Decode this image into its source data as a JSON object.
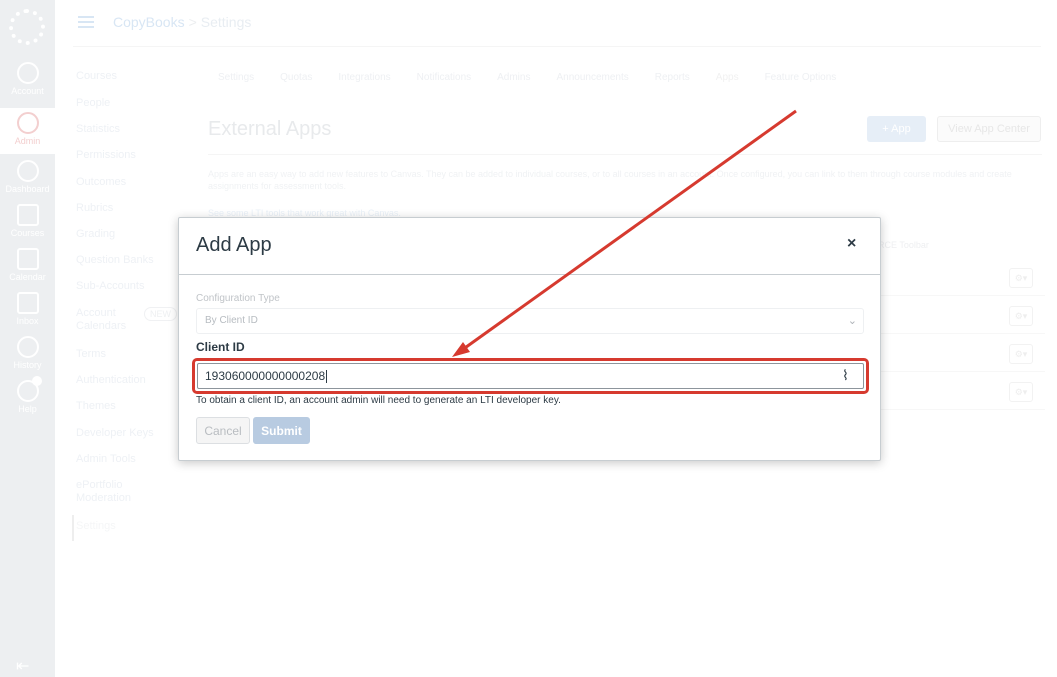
{
  "global_nav": {
    "items": [
      {
        "label": "Account",
        "icon": "account-icon"
      },
      {
        "label": "Admin",
        "icon": "admin-shield-icon"
      },
      {
        "label": "Dashboard",
        "icon": "dashboard-icon"
      },
      {
        "label": "Courses",
        "icon": "courses-icon"
      },
      {
        "label": "Calendar",
        "icon": "calendar-icon"
      },
      {
        "label": "Inbox",
        "icon": "inbox-icon"
      },
      {
        "label": "History",
        "icon": "history-icon"
      },
      {
        "label": "Help",
        "icon": "help-icon"
      }
    ]
  },
  "breadcrumb": {
    "account": "CopyBooks",
    "page": "Settings"
  },
  "course_nav": {
    "items": [
      "Courses",
      "People",
      "Statistics",
      "Permissions",
      "Outcomes",
      "Rubrics",
      "Grading",
      "Question Banks",
      "Sub-Accounts",
      "Account Calendars",
      "Terms",
      "Authentication",
      "Themes",
      "Developer Keys",
      "Admin Tools",
      "ePortfolio Moderation",
      "Settings"
    ],
    "new_badge": "NEW"
  },
  "tabs": [
    "Settings",
    "Quotas",
    "Integrations",
    "Notifications",
    "Admins",
    "Announcements",
    "Reports",
    "Apps",
    "Feature Options"
  ],
  "page": {
    "title": "External Apps",
    "add_app_label": "App",
    "view_app_center_label": "View App Center",
    "description": "Apps are an easy way to add new features to Canvas. They can be added to individual courses, or to all courses in an account. Once configured, you can link to them through course modules and create assignments for assessment tools.",
    "link_text": "See some LTI tools that work great with Canvas.",
    "rce_column": "RCE Toolbar"
  },
  "modal": {
    "title": "Add App",
    "close_label": "×",
    "config_type_label": "Configuration Type",
    "config_type_value": "By Client ID",
    "client_id_label": "Client ID",
    "client_id_value": "193060000000000208",
    "client_id_help": "To obtain a client ID, an account admin will need to generate an LTI developer key.",
    "cancel_label": "Cancel",
    "submit_label": "Submit"
  },
  "colors": {
    "highlight": "#d63a2f",
    "submit": "#b8cbe1"
  }
}
